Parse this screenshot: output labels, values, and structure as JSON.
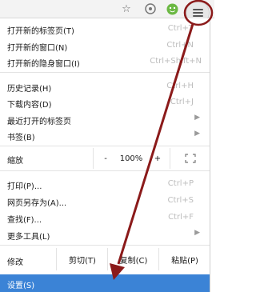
{
  "toolbar": {
    "icons": [
      "star-icon",
      "extension-icon",
      "avatar-icon",
      "menu-icon"
    ]
  },
  "menu": {
    "new_tab": {
      "label": "打开新的标签页(T)",
      "shortcut": "Ctrl+T"
    },
    "new_window": {
      "label": "打开新的窗口(N)",
      "shortcut": "Ctrl+N"
    },
    "new_incognito": {
      "label": "打开新的隐身窗口(I)",
      "shortcut": "Ctrl+Shift+N"
    },
    "history": {
      "label": "历史记录(H)",
      "shortcut": "Ctrl+H"
    },
    "downloads": {
      "label": "下载内容(D)",
      "shortcut": "Ctrl+J"
    },
    "recent_tabs": {
      "label": "最近打开的标签页"
    },
    "bookmarks": {
      "label": "书签(B)"
    },
    "zoom": {
      "label": "缩放",
      "minus": "-",
      "value": "100%",
      "plus": "+"
    },
    "print": {
      "label": "打印(P)...",
      "shortcut": "Ctrl+P"
    },
    "save_as": {
      "label": "网页另存为(A)...",
      "shortcut": "Ctrl+S"
    },
    "find": {
      "label": "查找(F)...",
      "shortcut": "Ctrl+F"
    },
    "more_tools": {
      "label": "更多工具(L)"
    },
    "edit": {
      "label": "修改",
      "cut": "剪切(T)",
      "copy": "复制(C)",
      "paste": "粘贴(P)"
    },
    "settings": {
      "label": "设置(S)"
    }
  },
  "colors": {
    "highlight": "#3b83d6",
    "annotation_arrow": "#8b1a1a"
  }
}
